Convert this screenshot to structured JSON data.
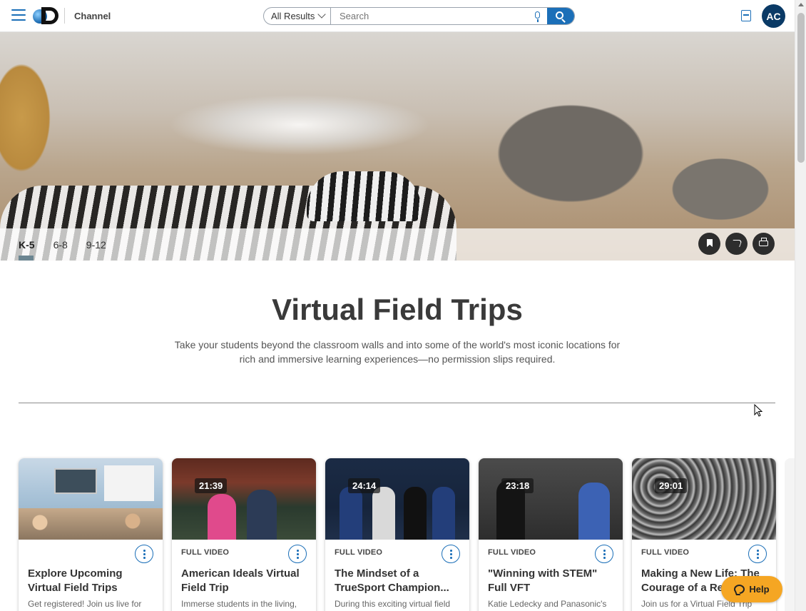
{
  "header": {
    "channel_label": "Channel",
    "search_scope": "All Results",
    "search_placeholder": "Search",
    "avatar_initials": "AC"
  },
  "hero": {
    "grade_tabs": [
      {
        "label": "K-5",
        "active": true
      },
      {
        "label": "6-8",
        "active": false
      },
      {
        "label": "9-12",
        "active": false
      }
    ],
    "actions": [
      "bookmark-icon",
      "share-icon",
      "print-icon"
    ]
  },
  "intro": {
    "title": "Virtual Field Trips",
    "description": "Take your students beyond the classroom walls and into some of the world's most iconic locations for rich and immersive learning experiences—no permission slips required."
  },
  "cards": [
    {
      "duration": "",
      "type": "",
      "title": "Explore Upcoming Virtual Field Trips",
      "description": "Get registered! Join us live for"
    },
    {
      "duration": "21:39",
      "type": "FULL VIDEO",
      "title": "American Ideals Virtual Field Trip",
      "description": "Immerse students in the living,"
    },
    {
      "duration": "24:14",
      "type": "FULL VIDEO",
      "title": "The Mindset of a TrueSport Champion...",
      "description": "During this exciting virtual field"
    },
    {
      "duration": "23:18",
      "type": "FULL VIDEO",
      "title": "\"Winning with STEM\" Full VFT",
      "description": "Katie Ledecky and Panasonic's"
    },
    {
      "duration": "29:01",
      "type": "FULL VIDEO",
      "title": "Making a New Life: The Courage of a Re",
      "description": "Join us for a Virtual Field Trip"
    }
  ],
  "help": {
    "label": "Help"
  },
  "colors": {
    "accent": "#1b6fb8",
    "avatar_bg": "#0a3a66",
    "help_bg": "#f5a623"
  }
}
